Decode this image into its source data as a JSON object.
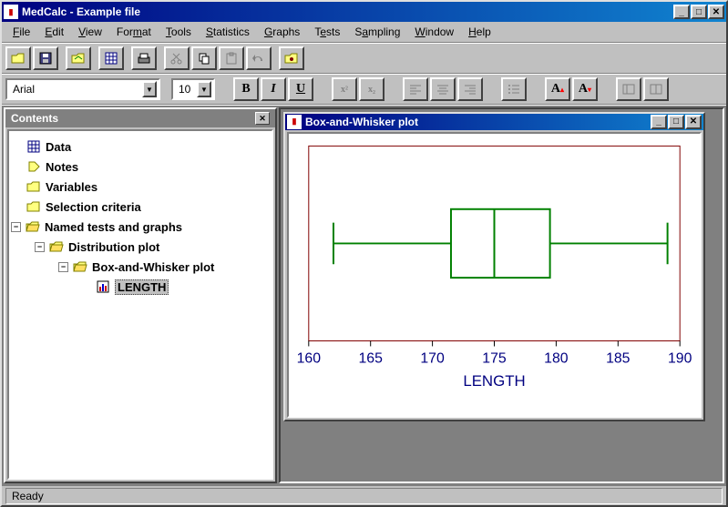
{
  "window": {
    "title": "MedCalc - Example file"
  },
  "menus": {
    "file": "File",
    "edit": "Edit",
    "view": "View",
    "format": "Format",
    "tools": "Tools",
    "statistics": "Statistics",
    "graphs": "Graphs",
    "tests": "Tests",
    "sampling": "Sampling",
    "window": "Window",
    "help": "Help"
  },
  "format": {
    "font": "Arial",
    "size": "10",
    "bold": "B",
    "italic": "I",
    "underline": "U"
  },
  "sidebar": {
    "title": "Contents",
    "nodes": {
      "data": "Data",
      "notes": "Notes",
      "variables": "Variables",
      "selection": "Selection criteria",
      "named": "Named tests and graphs",
      "dist": "Distribution plot",
      "box": "Box-and-Whisker plot",
      "length": "LENGTH"
    }
  },
  "child_window": {
    "title": "Box-and-Whisker plot"
  },
  "status": {
    "text": "Ready"
  },
  "chart_data": {
    "type": "boxplot",
    "xlabel": "LENGTH",
    "xlim": [
      160,
      190
    ],
    "ticks": [
      160,
      165,
      170,
      175,
      180,
      185,
      190
    ],
    "box": {
      "min": 162,
      "q1": 171.5,
      "median": 175,
      "q3": 179.5,
      "max": 189
    }
  }
}
